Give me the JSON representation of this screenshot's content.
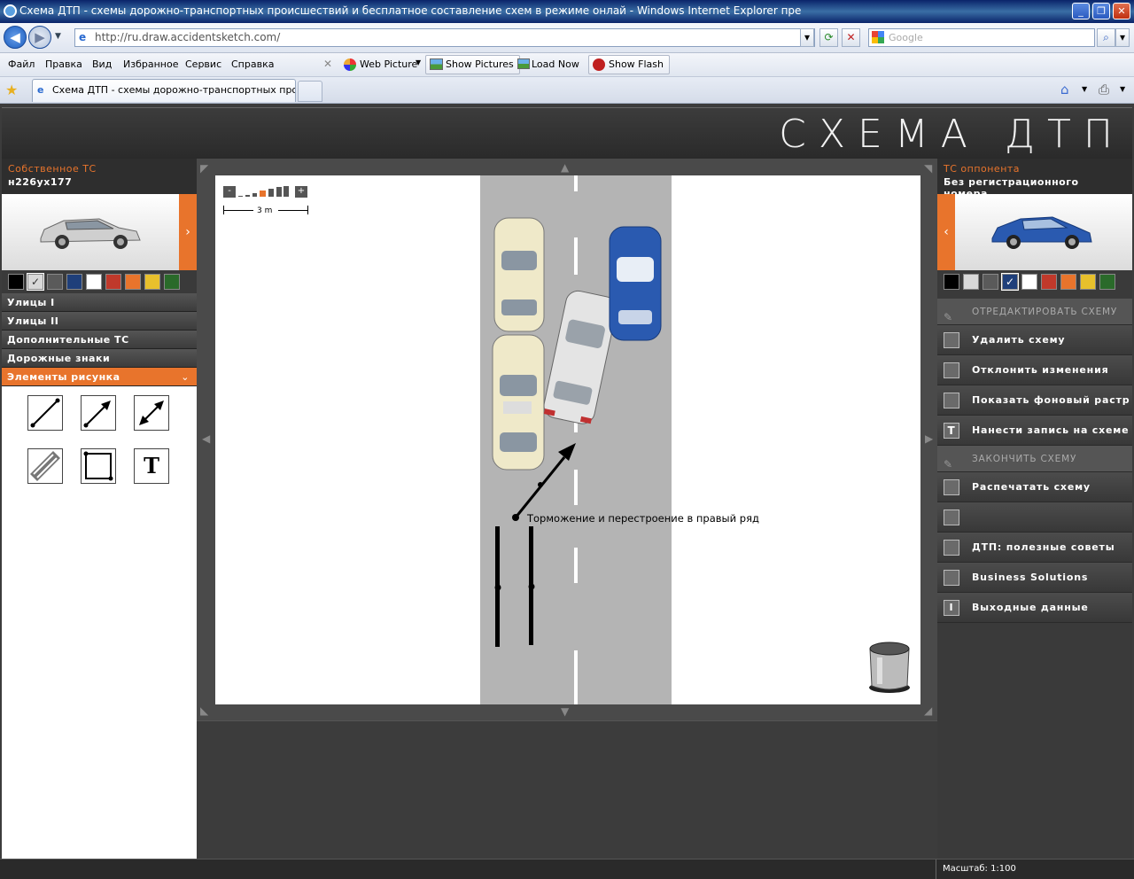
{
  "window": {
    "title": "Схема ДТП - схемы дорожно-транспортных происшествий и бесплатное составление схем в режиме онлай - Windows Internet Explorer пре"
  },
  "address": {
    "url": "http://ru.draw.accidentsketch.com/",
    "search_placeholder": "Google"
  },
  "menu": [
    "Файл",
    "Правка",
    "Вид",
    "Избранное",
    "Сервис",
    "Справка"
  ],
  "toolbar": {
    "web_picture": "Web Picture",
    "show_pictures": "Show Pictures",
    "load_now": "Load Now",
    "show_flash": "Show Flash"
  },
  "tab": {
    "label": "Схема ДТП - схемы дорожно-транспортных прош..."
  },
  "header": {
    "title": "СХЕМА ДТП"
  },
  "left_panel": {
    "label": "Собственное ТС",
    "plate": "н226ух177",
    "colors": [
      "#000000",
      "#d8d8d8",
      "#5a5a5a",
      "#1f3f7a",
      "#ffffff",
      "#c0392b",
      "#e8742c",
      "#e8c02c",
      "#2a6a2a"
    ],
    "selected_color": 1,
    "menu": [
      "Улицы I",
      "Улицы II",
      "Дополнительные ТС",
      "Дорожные знаки",
      "Элементы рисунка"
    ],
    "active_menu": 4
  },
  "right_panel": {
    "label": "ТС оппонента",
    "plate": "Без регистрационного номера",
    "colors": [
      "#000000",
      "#d8d8d8",
      "#5a5a5a",
      "#1f3f7a",
      "#ffffff",
      "#c0392b",
      "#e8742c",
      "#e8c02c",
      "#2a6a2a"
    ],
    "selected_color": 3,
    "edit_header": "ОТРЕДАКТИРОВАТЬ СХЕМУ",
    "delete": "Удалить схему",
    "undo": "Отклонить изменения",
    "show_raster": "Показать фоновый растр",
    "add_note": "Нанести запись на схеме",
    "finish_header": "ЗАКОНЧИТЬ СХЕМУ",
    "print": "Распечатать схему",
    "tips": "ДТП: полезные советы",
    "business": "Business Solutions",
    "imprint": "Выходные данные"
  },
  "canvas": {
    "scale_label": "3 m",
    "annotation": "Торможение и перестроение в правый ряд"
  },
  "status": {
    "scale": "Масштаб: 1:100"
  }
}
